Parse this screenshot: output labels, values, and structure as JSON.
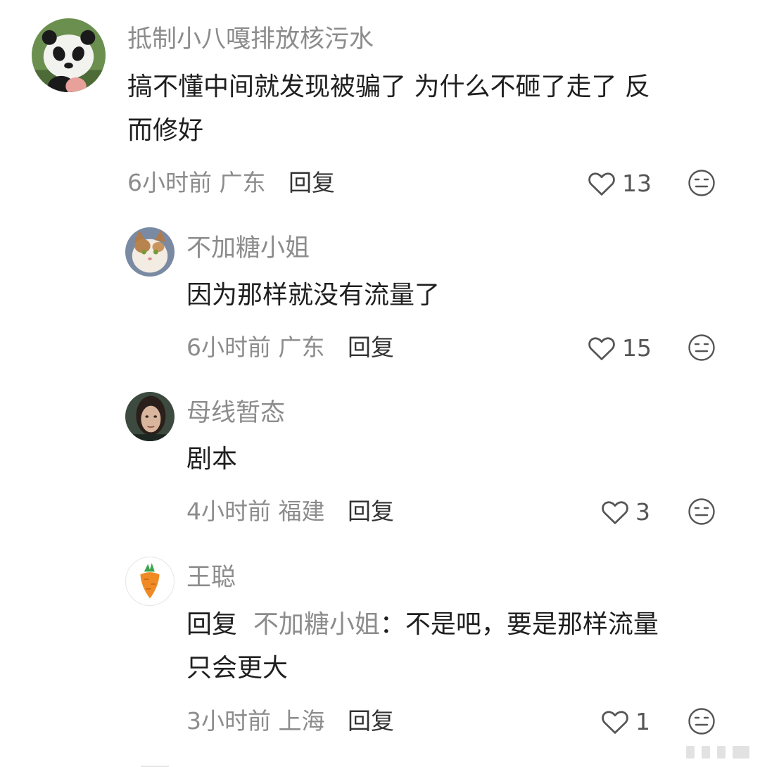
{
  "comments": [
    {
      "username": "抵制小八嘎排放核污水",
      "avatar_icon": "panda-avatar-icon",
      "text_line1": "搞不懂中间就发现被骗了 为什么不砸了走了 反",
      "text_line2": "而修好",
      "time": "6小时前",
      "location": "广东",
      "reply_label": "回复",
      "likes": "13"
    },
    {
      "username": "不加糖小姐",
      "avatar_icon": "cat-avatar-icon",
      "text": "因为那样就没有流量了",
      "time": "6小时前",
      "location": "广东",
      "reply_label": "回复",
      "likes": "15"
    },
    {
      "username": "母线暂态",
      "avatar_icon": "portrait-avatar-icon",
      "text": "剧本",
      "time": "4小时前",
      "location": "福建",
      "reply_label": "回复",
      "likes": "3"
    },
    {
      "username": "王聪",
      "avatar_icon": "carrot-avatar-icon",
      "reply_prefix": "回复",
      "reply_target": "不加糖小姐",
      "text_after": "：不是吧，要是那样流量",
      "text_line2": "只会更大",
      "time": "3小时前",
      "location": "上海",
      "reply_label": "回复",
      "likes": "1"
    }
  ],
  "icons": {
    "like": "heart-outline-icon",
    "dislike": "neutral-face-icon",
    "watermark": "weibo-watermark"
  },
  "colors": {
    "text": "#1f1f1f",
    "muted": "#8c8c8c",
    "accent_orange": "#f08a24",
    "leaf_green": "#3aa34a"
  }
}
